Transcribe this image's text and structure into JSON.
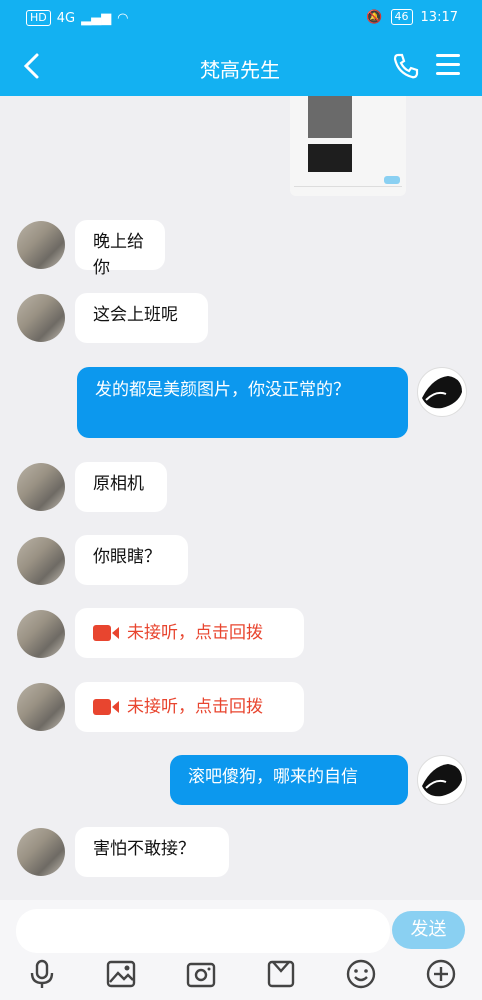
{
  "status": {
    "hd": "HD",
    "signal": "4G",
    "battery": "46",
    "time": "13:17"
  },
  "header": {
    "title": "梵高先生"
  },
  "messages": [
    {
      "side": "left",
      "text": "晚上给你"
    },
    {
      "side": "left",
      "text": "这会上班呢"
    },
    {
      "side": "right",
      "text": "发的都是美颜图片，你没正常的？"
    },
    {
      "side": "left",
      "text": "原相机"
    },
    {
      "side": "left",
      "text": "你眼瞎？"
    },
    {
      "side": "left",
      "text": "未接听，点击回拨",
      "type": "missed-video-call"
    },
    {
      "side": "left",
      "text": "未接听，点击回拨",
      "type": "missed-video-call"
    },
    {
      "side": "right",
      "text": "滚吧傻狗，哪来的自信"
    },
    {
      "side": "left",
      "text": "害怕不敢接？"
    }
  ],
  "input": {
    "placeholder": "",
    "send_label": "发送"
  },
  "toolbar": [
    "microphone-icon",
    "image-icon",
    "camera-icon",
    "gift-icon",
    "emoji-icon",
    "plus-icon"
  ],
  "colors": {
    "accent": "#13b1f2",
    "bubble_out": "#0c98ee",
    "missed_call": "#e8452f"
  }
}
